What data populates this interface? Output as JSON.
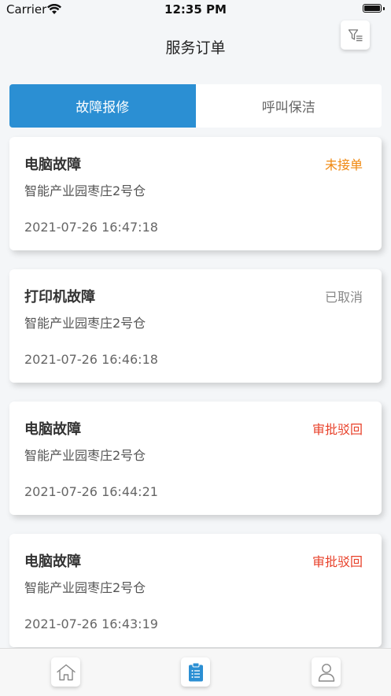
{
  "status_bar": {
    "carrier": "Carrier",
    "time": "12:35 PM"
  },
  "header": {
    "title": "服务订单",
    "filter_icon": "filter-list-icon"
  },
  "tabs": [
    {
      "label": "故障报修",
      "active": true
    },
    {
      "label": "呼叫保洁",
      "active": false
    }
  ],
  "orders": [
    {
      "title": "电脑故障",
      "status": "未接单",
      "status_color": "#f0880f",
      "location": "智能产业园枣庄2号仓",
      "time": "2021-07-26 16:47:18"
    },
    {
      "title": "打印机故障",
      "status": "已取消",
      "status_color": "#888888",
      "location": "智能产业园枣庄2号仓",
      "time": "2021-07-26 16:46:18"
    },
    {
      "title": "电脑故障",
      "status": "审批驳回",
      "status_color": "#e8412a",
      "location": "智能产业园枣庄2号仓",
      "time": "2021-07-26 16:44:21"
    },
    {
      "title": "电脑故障",
      "status": "审批驳回",
      "status_color": "#e8412a",
      "location": "智能产业园枣庄2号仓",
      "time": "2021-07-26 16:43:19"
    }
  ],
  "bottom_nav": [
    {
      "icon": "home-icon",
      "active": false
    },
    {
      "icon": "clipboard-icon",
      "active": true
    },
    {
      "icon": "user-icon",
      "active": false
    }
  ],
  "colors": {
    "accent": "#2b8fd3"
  }
}
